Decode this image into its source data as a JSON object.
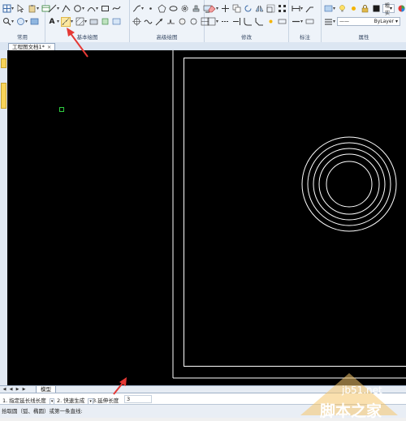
{
  "ribbon": {
    "groups": [
      {
        "label": "常用"
      },
      {
        "label": "基本绘图"
      },
      {
        "label": "高级绘图"
      },
      {
        "label": "修改"
      },
      {
        "label": "标注"
      },
      {
        "label": "属性"
      }
    ],
    "text_tool_label": "A",
    "linetype_value": "ByLayer",
    "linetype_prefix": "——",
    "lineweight_label": "粗实",
    "colors": {
      "accent_arrow": "#e53935",
      "highlight": "#fbe7a1"
    }
  },
  "document_tab": {
    "title": "工程图文档1*",
    "close_glyph": "×"
  },
  "layout_tabs": {
    "model_tab": "模型"
  },
  "command_options": [
    {
      "num": "1.",
      "label": "指定延长线长度"
    },
    {
      "num": "2.",
      "label": "快速生成"
    },
    {
      "num": "3.",
      "label": "延伸长度"
    }
  ],
  "command_value": "3",
  "prompt_text": "拾取圆（弧、椭圆）或第一条直线:",
  "watermark": {
    "url": "jb51.net",
    "brand": "脚本之家"
  }
}
